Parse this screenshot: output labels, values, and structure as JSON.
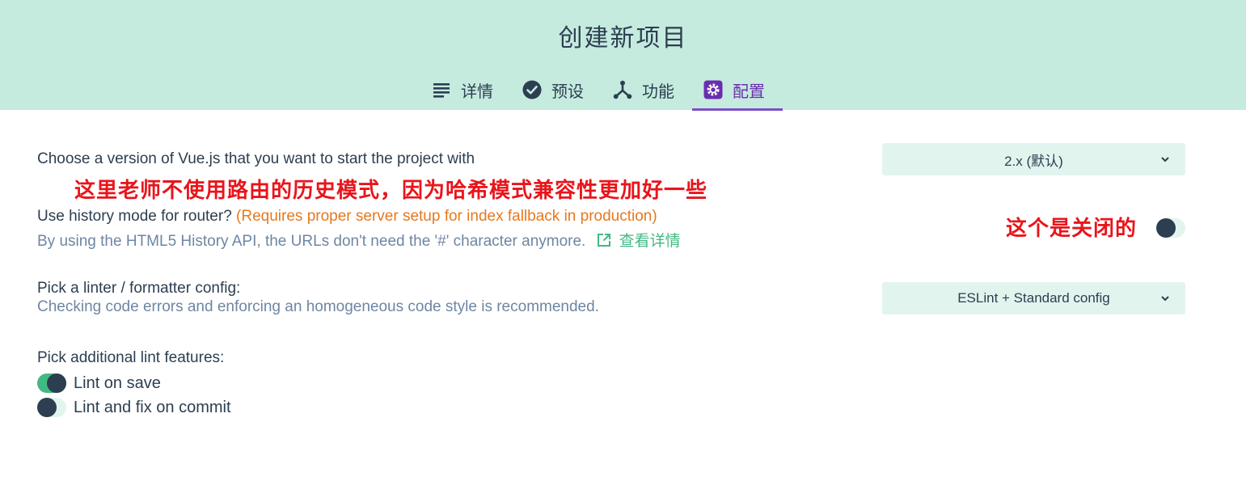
{
  "header": {
    "title": "创建新项目",
    "tabs": [
      {
        "label": "详情",
        "icon": "list-icon",
        "active": false
      },
      {
        "label": "预设",
        "icon": "check-circle-icon",
        "active": false
      },
      {
        "label": "功能",
        "icon": "fork-icon",
        "active": false
      },
      {
        "label": "配置",
        "icon": "gear-icon",
        "active": true
      }
    ]
  },
  "config": {
    "vue_version": {
      "title": "Choose a version of Vue.js that you want to start the project with",
      "selected": "2.x (默认)"
    },
    "history_mode": {
      "title": "Use history mode for router?",
      "warning": "(Requires proper server setup for index fallback in production)",
      "description": "By using the HTML5 History API, the URLs don't need the '#' character anymore.",
      "link_label": "查看详情",
      "enabled": false
    },
    "linter": {
      "title": "Pick a linter / formatter config:",
      "description": "Checking code errors and enforcing an homogeneous code style is recommended.",
      "selected": "ESLint + Standard config"
    },
    "lint_features": {
      "title": "Pick additional lint features:",
      "options": [
        {
          "label": "Lint on save",
          "enabled": true
        },
        {
          "label": "Lint and fix on commit",
          "enabled": false
        }
      ]
    }
  },
  "annotations": {
    "history_note": "这里老师不使用路由的历史模式，因为哈希模式兼容性更加好一些",
    "toggle_note": "这个是关闭的"
  },
  "colors": {
    "header_bg": "#c5ebdf",
    "accent_green": "#42b983",
    "active_tab": "#6a2db0",
    "text_dark": "#2c3e50",
    "warning": "#e5791e",
    "annotation_red": "#e8151b"
  }
}
